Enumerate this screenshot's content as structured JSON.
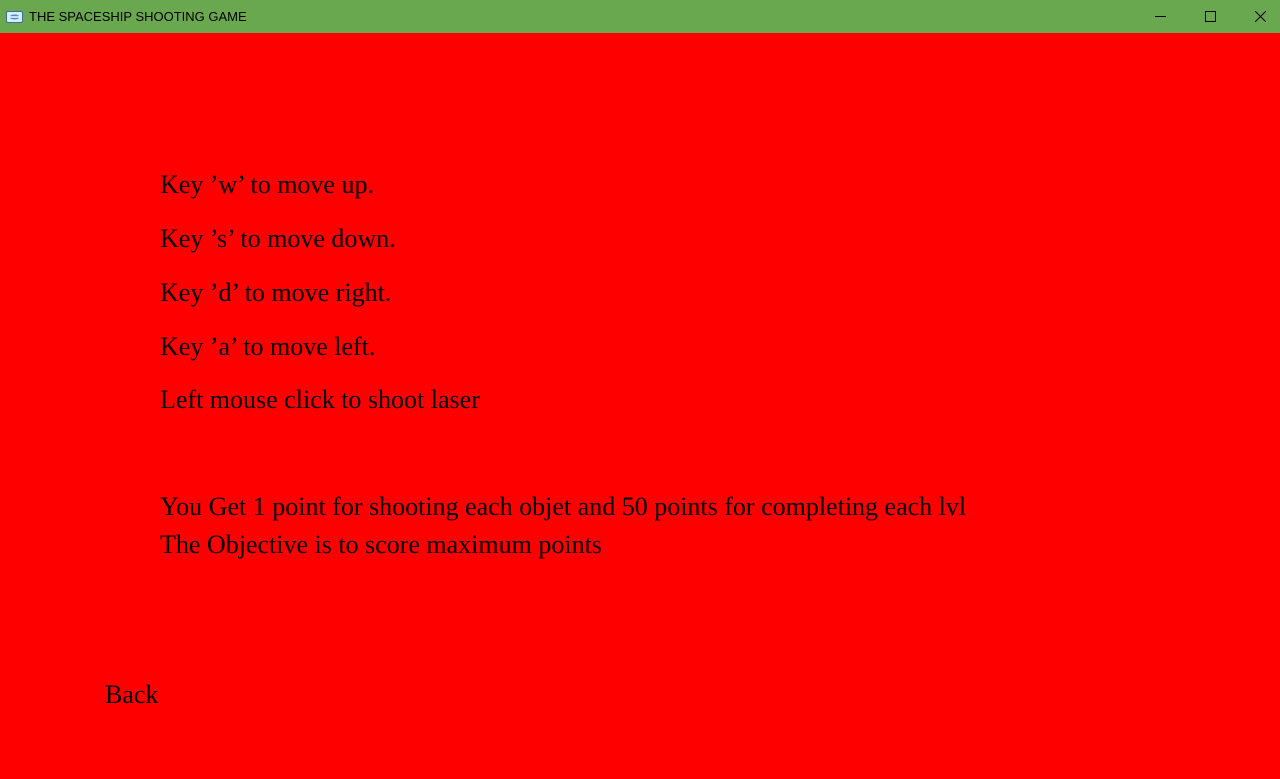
{
  "window": {
    "title": "THE SPACESHIP SHOOTING GAME",
    "titlebar_color": "#6aa84f",
    "background_color": "#ff0000",
    "icons": {
      "app": "app-icon",
      "minimize": "minimize-icon",
      "maximize": "maximize-icon",
      "close": "close-icon"
    }
  },
  "instructions": {
    "controls": [
      "Key ’w’ to move up.",
      "Key ’s’ to move down.",
      "Key ’d’ to move right.",
      "Key ’a’ to move left.",
      "Left mouse click to shoot laser"
    ],
    "scoring": [
      "You Get 1 point for shooting each objet and 50 points for completing each lvl",
      "The Objective is to score maximum points"
    ]
  },
  "back_label": "Back"
}
